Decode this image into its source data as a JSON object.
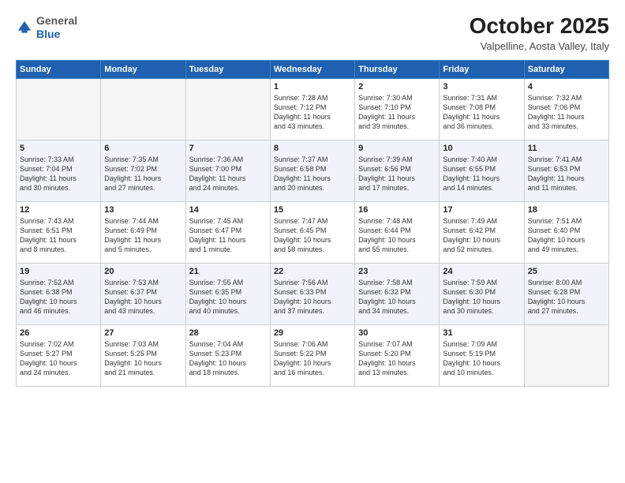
{
  "logo": {
    "general": "General",
    "blue": "Blue"
  },
  "header": {
    "title": "October 2025",
    "subtitle": "Valpelline, Aosta Valley, Italy"
  },
  "weekdays": [
    "Sunday",
    "Monday",
    "Tuesday",
    "Wednesday",
    "Thursday",
    "Friday",
    "Saturday"
  ],
  "weeks": [
    [
      {
        "day": "",
        "info": ""
      },
      {
        "day": "",
        "info": ""
      },
      {
        "day": "",
        "info": ""
      },
      {
        "day": "1",
        "info": "Sunrise: 7:28 AM\nSunset: 7:12 PM\nDaylight: 11 hours\nand 43 minutes."
      },
      {
        "day": "2",
        "info": "Sunrise: 7:30 AM\nSunset: 7:10 PM\nDaylight: 11 hours\nand 39 minutes."
      },
      {
        "day": "3",
        "info": "Sunrise: 7:31 AM\nSunset: 7:08 PM\nDaylight: 11 hours\nand 36 minutes."
      },
      {
        "day": "4",
        "info": "Sunrise: 7:32 AM\nSunset: 7:06 PM\nDaylight: 11 hours\nand 33 minutes."
      }
    ],
    [
      {
        "day": "5",
        "info": "Sunrise: 7:33 AM\nSunset: 7:04 PM\nDaylight: 11 hours\nand 30 minutes."
      },
      {
        "day": "6",
        "info": "Sunrise: 7:35 AM\nSunset: 7:02 PM\nDaylight: 11 hours\nand 27 minutes."
      },
      {
        "day": "7",
        "info": "Sunrise: 7:36 AM\nSunset: 7:00 PM\nDaylight: 11 hours\nand 24 minutes."
      },
      {
        "day": "8",
        "info": "Sunrise: 7:37 AM\nSunset: 6:58 PM\nDaylight: 11 hours\nand 20 minutes."
      },
      {
        "day": "9",
        "info": "Sunrise: 7:39 AM\nSunset: 6:56 PM\nDaylight: 11 hours\nand 17 minutes."
      },
      {
        "day": "10",
        "info": "Sunrise: 7:40 AM\nSunset: 6:55 PM\nDaylight: 11 hours\nand 14 minutes."
      },
      {
        "day": "11",
        "info": "Sunrise: 7:41 AM\nSunset: 6:53 PM\nDaylight: 11 hours\nand 11 minutes."
      }
    ],
    [
      {
        "day": "12",
        "info": "Sunrise: 7:43 AM\nSunset: 6:51 PM\nDaylight: 11 hours\nand 8 minutes."
      },
      {
        "day": "13",
        "info": "Sunrise: 7:44 AM\nSunset: 6:49 PM\nDaylight: 11 hours\nand 5 minutes."
      },
      {
        "day": "14",
        "info": "Sunrise: 7:45 AM\nSunset: 6:47 PM\nDaylight: 11 hours\nand 1 minute."
      },
      {
        "day": "15",
        "info": "Sunrise: 7:47 AM\nSunset: 6:45 PM\nDaylight: 10 hours\nand 58 minutes."
      },
      {
        "day": "16",
        "info": "Sunrise: 7:48 AM\nSunset: 6:44 PM\nDaylight: 10 hours\nand 55 minutes."
      },
      {
        "day": "17",
        "info": "Sunrise: 7:49 AM\nSunset: 6:42 PM\nDaylight: 10 hours\nand 52 minutes."
      },
      {
        "day": "18",
        "info": "Sunrise: 7:51 AM\nSunset: 6:40 PM\nDaylight: 10 hours\nand 49 minutes."
      }
    ],
    [
      {
        "day": "19",
        "info": "Sunrise: 7:52 AM\nSunset: 6:38 PM\nDaylight: 10 hours\nand 46 minutes."
      },
      {
        "day": "20",
        "info": "Sunrise: 7:53 AM\nSunset: 6:37 PM\nDaylight: 10 hours\nand 43 minutes."
      },
      {
        "day": "21",
        "info": "Sunrise: 7:55 AM\nSunset: 6:35 PM\nDaylight: 10 hours\nand 40 minutes."
      },
      {
        "day": "22",
        "info": "Sunrise: 7:56 AM\nSunset: 6:33 PM\nDaylight: 10 hours\nand 37 minutes."
      },
      {
        "day": "23",
        "info": "Sunrise: 7:58 AM\nSunset: 6:32 PM\nDaylight: 10 hours\nand 34 minutes."
      },
      {
        "day": "24",
        "info": "Sunrise: 7:59 AM\nSunset: 6:30 PM\nDaylight: 10 hours\nand 30 minutes."
      },
      {
        "day": "25",
        "info": "Sunrise: 8:00 AM\nSunset: 6:28 PM\nDaylight: 10 hours\nand 27 minutes."
      }
    ],
    [
      {
        "day": "26",
        "info": "Sunrise: 7:02 AM\nSunset: 5:27 PM\nDaylight: 10 hours\nand 24 minutes."
      },
      {
        "day": "27",
        "info": "Sunrise: 7:03 AM\nSunset: 5:25 PM\nDaylight: 10 hours\nand 21 minutes."
      },
      {
        "day": "28",
        "info": "Sunrise: 7:04 AM\nSunset: 5:23 PM\nDaylight: 10 hours\nand 18 minutes."
      },
      {
        "day": "29",
        "info": "Sunrise: 7:06 AM\nSunset: 5:22 PM\nDaylight: 10 hours\nand 16 minutes."
      },
      {
        "day": "30",
        "info": "Sunrise: 7:07 AM\nSunset: 5:20 PM\nDaylight: 10 hours\nand 13 minutes."
      },
      {
        "day": "31",
        "info": "Sunrise: 7:09 AM\nSunset: 5:19 PM\nDaylight: 10 hours\nand 10 minutes."
      },
      {
        "day": "",
        "info": ""
      }
    ]
  ]
}
